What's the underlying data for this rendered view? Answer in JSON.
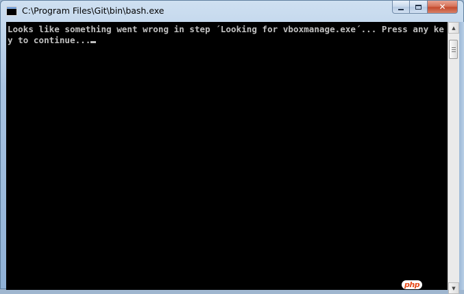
{
  "window": {
    "title": "C:\\Program Files\\Git\\bin\\bash.exe",
    "app_icon": "console-icon",
    "buttons": {
      "minimize": "minimize-icon",
      "maximize": "maximize-icon",
      "close_glyph": "✕"
    }
  },
  "console": {
    "text": "Looks like something went wrong in step ´Looking for vboxmanage.exe´... Press any key to continue..."
  },
  "scrollbar": {
    "up_arrow": "▲",
    "down_arrow": "▼"
  },
  "watermark": {
    "text": "php"
  }
}
